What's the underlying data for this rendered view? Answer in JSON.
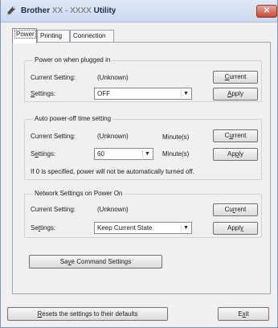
{
  "window": {
    "title_prefix": "Brother ",
    "title_model": "XX - XXXX",
    "title_suffix": " Utility",
    "close_glyph": "✕"
  },
  "tabs": [
    {
      "label": "Power",
      "active": true
    },
    {
      "label": "Printing",
      "active": false
    },
    {
      "label": "Connection",
      "active": false
    }
  ],
  "power_on": {
    "title": "Power on when plugged in",
    "current_label": "Current Setting:",
    "current_value": "(Unknown)",
    "settings_label_pre": "",
    "settings_label_u": "S",
    "settings_label_post": "ettings:",
    "selected": "OFF",
    "current_btn_pre": "",
    "current_btn_u": "C",
    "current_btn_post": "urrent",
    "apply_btn_pre": "",
    "apply_btn_u": "A",
    "apply_btn_post": "pply"
  },
  "auto_off": {
    "title": "Auto power-off time setting",
    "current_label": "Current Setting:",
    "current_value": "(Unknown)",
    "unit1": "Minute(s)",
    "settings_label_pre": "S",
    "settings_label_u": "e",
    "settings_label_post": "ttings:",
    "selected": "60",
    "unit2": "Minute(s)",
    "note": "If 0 is specified, power will not be automatically turned off.",
    "current_btn_pre": "C",
    "current_btn_u": "u",
    "current_btn_post": "rrent",
    "apply_btn_pre": "Ap",
    "apply_btn_u": "p",
    "apply_btn_post": "ly"
  },
  "network": {
    "title": "Network Settings on Power On",
    "current_label": "Current Setting:",
    "current_value": "(Unknown)",
    "settings_label_pre": "Se",
    "settings_label_u": "t",
    "settings_label_post": "tings:",
    "selected": "Keep Current State",
    "current_btn_pre": "Cu",
    "current_btn_u": "r",
    "current_btn_post": "rent",
    "apply_btn_pre": "Appl",
    "apply_btn_u": "y",
    "apply_btn_post": ""
  },
  "save_btn": {
    "pre": "Sa",
    "u": "v",
    "post": "e Command Settings"
  },
  "reset_btn": {
    "pre": "",
    "u": "R",
    "post": "esets the settings to their defaults"
  },
  "exit_btn": {
    "pre": "E",
    "u": "x",
    "post": "it"
  },
  "dropdown_arrow": "▼"
}
